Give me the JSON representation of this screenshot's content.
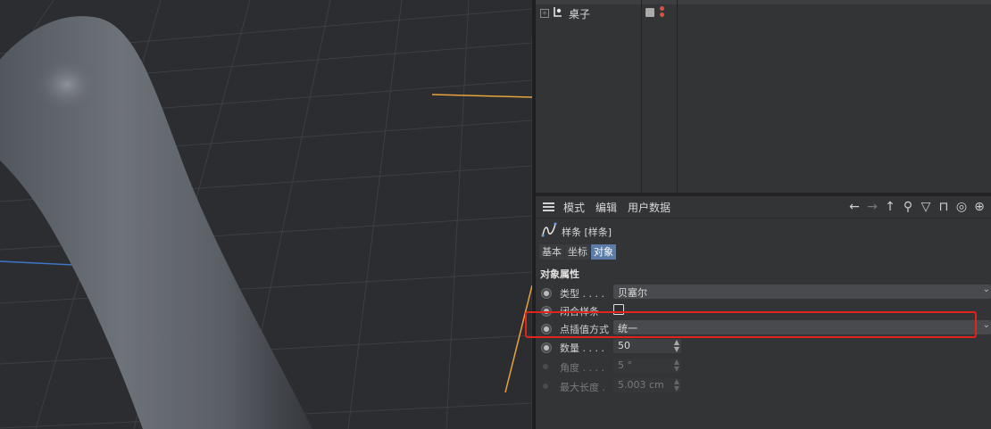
{
  "object_manager": {
    "rows": [
      {
        "expand": "+",
        "name": "桌子"
      }
    ]
  },
  "attribute_manager": {
    "menu": [
      "模式",
      "编辑",
      "用户数据"
    ],
    "toolbar_icons": [
      "back-arrow-icon",
      "forward-arrow-icon",
      "up-arrow-icon",
      "search-icon",
      "filter-icon",
      "lock-icon",
      "target-icon",
      "add-icon"
    ],
    "object_title": "样条 [样条]",
    "tabs": [
      "基本",
      "坐标",
      "对象"
    ],
    "active_tab": "对象",
    "section_title": "对象属性",
    "properties": {
      "type": {
        "label": "类型 . . . .",
        "value": "贝塞尔"
      },
      "close_spline": {
        "label": "闭合样条",
        "checked": false
      },
      "interpolation": {
        "label": "点插值方式",
        "value": "统一"
      },
      "count": {
        "label": "数量 . . . .",
        "value": "50"
      },
      "angle": {
        "label": "角度 . . . .",
        "value": "5 °"
      },
      "max_length": {
        "label": "最大长度 .",
        "value": "5.003 cm"
      }
    }
  },
  "colors": {
    "highlight": "#e0231b",
    "active_tab": "#5b7ca8",
    "spline": "#e8a33c"
  }
}
